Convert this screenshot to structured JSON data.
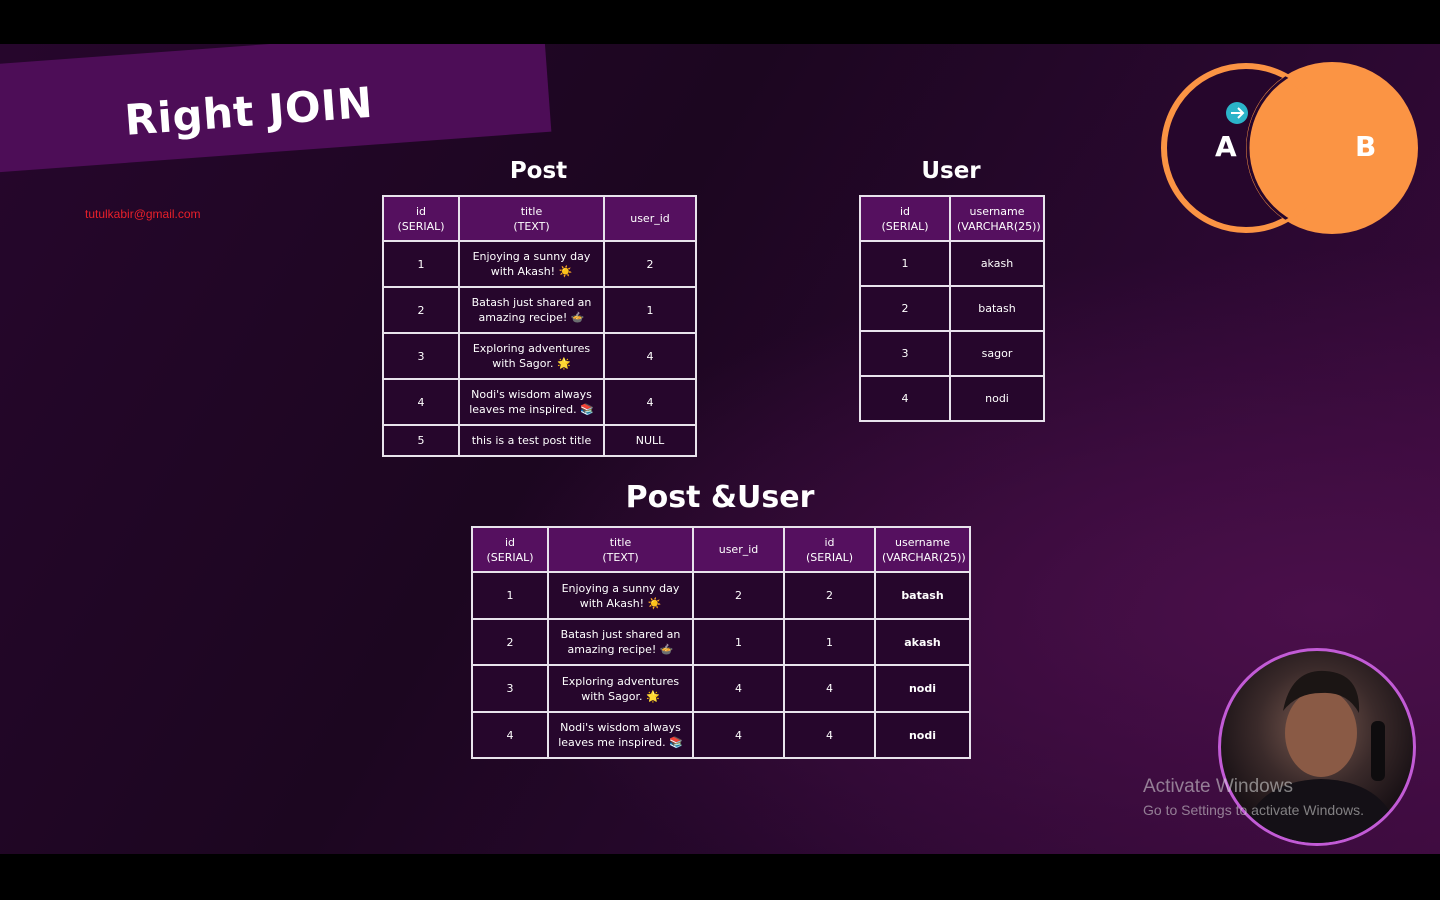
{
  "banner": {
    "title": "Right JOIN"
  },
  "email": "tutulkabir@gmail.com",
  "venn": {
    "a": "A",
    "b": "B",
    "circle_color": "#fb9444",
    "arrow_color": "#2bb3c9"
  },
  "post": {
    "title": "Post",
    "headers": [
      [
        "id",
        "(SERIAL)"
      ],
      [
        "title",
        "(TEXT)"
      ],
      [
        "user_id",
        ""
      ]
    ],
    "rows": [
      [
        "1",
        "Enjoying a sunny day with Akash! ☀️",
        "2"
      ],
      [
        "2",
        "Batash just shared an amazing recipe! 🍲",
        "1"
      ],
      [
        "3",
        "Exploring adventures with Sagor. 🌟",
        "4"
      ],
      [
        "4",
        "Nodi's wisdom always leaves me inspired. 📚",
        "4"
      ],
      [
        "5",
        "this is a test post title",
        "NULL"
      ]
    ]
  },
  "user": {
    "title": "User",
    "headers": [
      [
        "id",
        "(SERIAL)"
      ],
      [
        "username",
        "(VARCHAR(25))"
      ]
    ],
    "rows": [
      [
        "1",
        "akash"
      ],
      [
        "2",
        "batash"
      ],
      [
        "3",
        "sagor"
      ],
      [
        "4",
        "nodi"
      ]
    ]
  },
  "joined": {
    "title": "Post &User",
    "headers": [
      [
        "id",
        "(SERIAL)"
      ],
      [
        "title",
        "(TEXT)"
      ],
      [
        "user_id",
        ""
      ],
      [
        "id",
        "(SERIAL)"
      ],
      [
        "username",
        "(VARCHAR(25))"
      ]
    ],
    "rows": [
      [
        "1",
        "Enjoying a sunny day with Akash! ☀️",
        "2",
        "2",
        "batash"
      ],
      [
        "2",
        "Batash just shared an amazing recipe! 🍲",
        "1",
        "1",
        "akash"
      ],
      [
        "3",
        "Exploring adventures with Sagor. 🌟",
        "4",
        "4",
        "nodi"
      ],
      [
        "4",
        "Nodi's wisdom always leaves me inspired. 📚",
        "4",
        "4",
        "nodi"
      ]
    ]
  },
  "watermark": {
    "line1": "Activate Windows",
    "line2": "Go to Settings to activate Windows."
  },
  "colors": {
    "banner": "#4d0d57",
    "header_bg": "#55105f",
    "email": "#e8202a"
  }
}
